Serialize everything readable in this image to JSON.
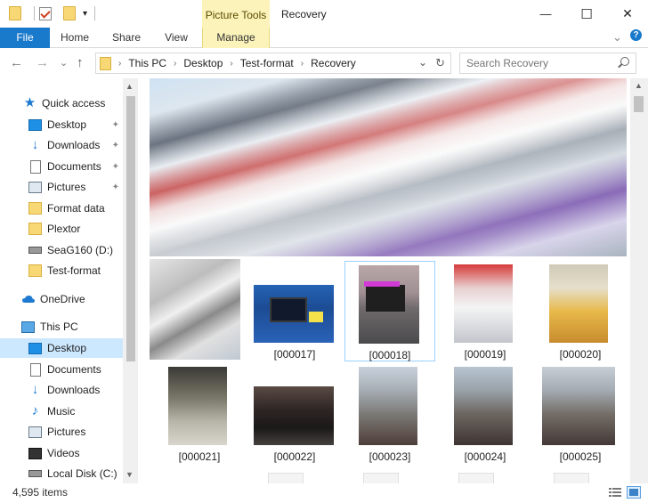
{
  "window": {
    "title": "Recovery",
    "context_tab_group": "Picture Tools",
    "controls": {
      "minimize": "—",
      "maximize": "☐",
      "close": "✕"
    }
  },
  "quick_access_toolbar": {
    "dropdown": "▾"
  },
  "ribbon": {
    "tabs": [
      "File",
      "Home",
      "Share",
      "View",
      "Manage"
    ],
    "expand_glyph": "⌄",
    "help_glyph": "?"
  },
  "nav": {
    "back": "←",
    "forward": "→",
    "recent": "⌄",
    "up": "↑",
    "breadcrumb": [
      "This PC",
      "Desktop",
      "Test-format",
      "Recovery"
    ],
    "breadcrumb_sep": "›",
    "dropdown": "⌄",
    "refresh": "↻",
    "search_placeholder": "Search Recovery"
  },
  "sidebar": {
    "items": [
      {
        "label": "Quick access",
        "icon": "star-icon",
        "pinned": false
      },
      {
        "label": "Desktop",
        "icon": "desktop-icon",
        "pinned": true
      },
      {
        "label": "Downloads",
        "icon": "downloads-icon",
        "pinned": true
      },
      {
        "label": "Documents",
        "icon": "documents-icon",
        "pinned": true
      },
      {
        "label": "Pictures",
        "icon": "pictures-icon",
        "pinned": true
      },
      {
        "label": "Format data",
        "icon": "folder-icon",
        "pinned": false
      },
      {
        "label": "Plextor",
        "icon": "folder-icon",
        "pinned": false
      },
      {
        "label": "SeaG160 (D:)",
        "icon": "drive-icon",
        "pinned": false
      },
      {
        "label": "Test-format",
        "icon": "folder-icon",
        "pinned": false
      },
      {
        "label": "OneDrive",
        "icon": "onedrive-icon",
        "pinned": false
      },
      {
        "label": "This PC",
        "icon": "this-pc-icon",
        "pinned": false
      },
      {
        "label": "Desktop",
        "icon": "desktop-icon",
        "pinned": false,
        "selected": true
      },
      {
        "label": "Documents",
        "icon": "documents-icon",
        "pinned": false
      },
      {
        "label": "Downloads",
        "icon": "downloads-icon",
        "pinned": false
      },
      {
        "label": "Music",
        "icon": "music-icon",
        "pinned": false
      },
      {
        "label": "Pictures",
        "icon": "pictures-icon",
        "pinned": false
      },
      {
        "label": "Videos",
        "icon": "videos-icon",
        "pinned": false
      },
      {
        "label": "Local Disk (C:)",
        "icon": "drive-icon",
        "pinned": false
      }
    ],
    "pin_glyph": "📌"
  },
  "files": [
    {
      "name": "[000017]"
    },
    {
      "name": "[000018]",
      "selected": true
    },
    {
      "name": "[000019]"
    },
    {
      "name": "[000020]"
    },
    {
      "name": "[000021]"
    },
    {
      "name": "[000022]"
    },
    {
      "name": "[000023]"
    },
    {
      "name": "[000024]"
    },
    {
      "name": "[000025]"
    }
  ],
  "status": {
    "item_count": "4,595 items"
  },
  "colors": {
    "accent": "#1979ca",
    "context_tab": "#fcf3ba",
    "selection": "#cce8ff"
  }
}
